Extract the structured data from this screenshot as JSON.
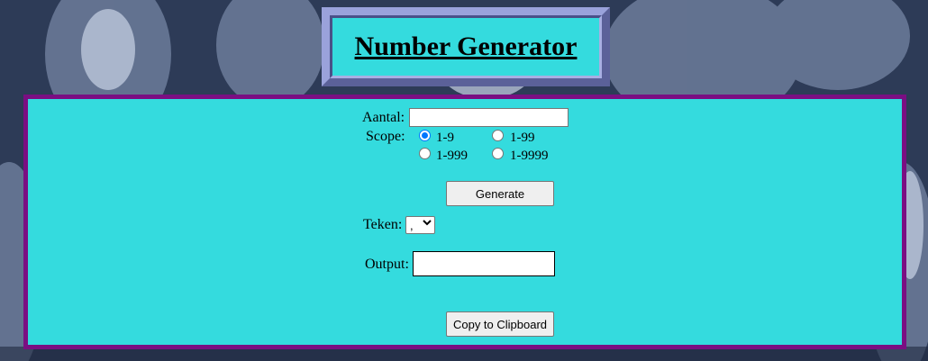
{
  "page": {
    "title": "Number Generator"
  },
  "form": {
    "amount_label": "Aantal:",
    "amount_value": "",
    "scope_label": "Scope:",
    "scope_options": [
      {
        "label": "1-9",
        "checked": true
      },
      {
        "label": "1-99",
        "checked": false
      },
      {
        "label": "1-999",
        "checked": false
      },
      {
        "label": "1-9999",
        "checked": false
      }
    ],
    "generate_button": "Generate",
    "separator_label": "Teken:",
    "separator_value": ",",
    "output_label": "Output:",
    "output_value": "",
    "copy_button": "Copy to Clipboard"
  },
  "colors": {
    "panel_bg": "#34dbde",
    "panel_border": "#7a0f82",
    "title_frame": "#7b84c6",
    "radio_selected": "#0075ff"
  },
  "icons": {
    "select_arrow": "chevron-down-icon"
  }
}
